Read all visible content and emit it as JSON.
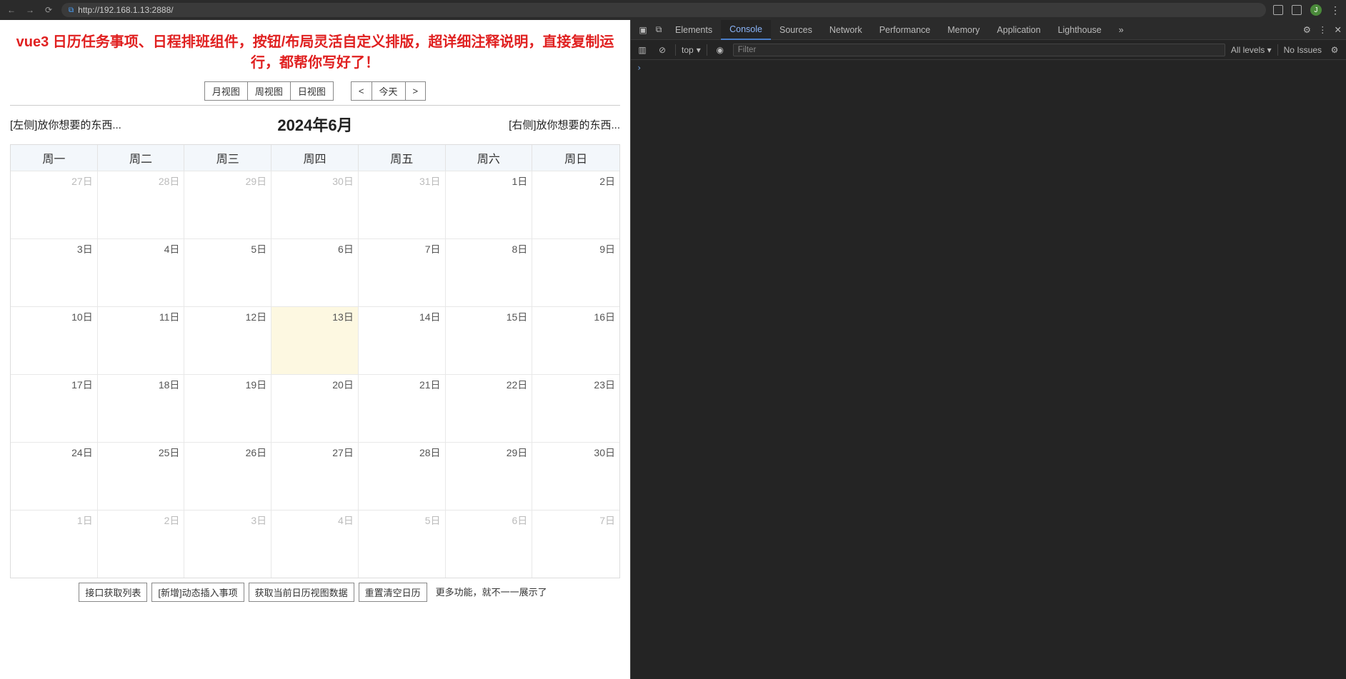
{
  "browser": {
    "url": "http://192.168.1.13:2888/",
    "avatar_letter": "J"
  },
  "page": {
    "title": "vue3 日历任务事项、日程排班组件，按钮/布局灵活自定义排版，超详细注释说明，直接复制运行，都帮你写好了！",
    "view_buttons": [
      "月视图",
      "周视图",
      "日视图"
    ],
    "nav_prev": "<",
    "nav_today": "今天",
    "nav_next": ">",
    "left_slot": "[左侧]放你想要的东西...",
    "right_slot": "[右侧]放你想要的东西...",
    "month_title": "2024年6月",
    "weekdays": [
      "周一",
      "周二",
      "周三",
      "周四",
      "周五",
      "周六",
      "周日"
    ],
    "days": [
      {
        "label": "27日",
        "outside": true
      },
      {
        "label": "28日",
        "outside": true
      },
      {
        "label": "29日",
        "outside": true
      },
      {
        "label": "30日",
        "outside": true
      },
      {
        "label": "31日",
        "outside": true
      },
      {
        "label": "1日"
      },
      {
        "label": "2日"
      },
      {
        "label": "3日"
      },
      {
        "label": "4日"
      },
      {
        "label": "5日"
      },
      {
        "label": "6日"
      },
      {
        "label": "7日"
      },
      {
        "label": "8日"
      },
      {
        "label": "9日"
      },
      {
        "label": "10日"
      },
      {
        "label": "11日"
      },
      {
        "label": "12日"
      },
      {
        "label": "13日",
        "today": true
      },
      {
        "label": "14日"
      },
      {
        "label": "15日"
      },
      {
        "label": "16日"
      },
      {
        "label": "17日"
      },
      {
        "label": "18日"
      },
      {
        "label": "19日"
      },
      {
        "label": "20日"
      },
      {
        "label": "21日"
      },
      {
        "label": "22日"
      },
      {
        "label": "23日"
      },
      {
        "label": "24日"
      },
      {
        "label": "25日"
      },
      {
        "label": "26日"
      },
      {
        "label": "27日"
      },
      {
        "label": "28日"
      },
      {
        "label": "29日"
      },
      {
        "label": "30日"
      },
      {
        "label": "1日",
        "outside": true
      },
      {
        "label": "2日",
        "outside": true
      },
      {
        "label": "3日",
        "outside": true
      },
      {
        "label": "4日",
        "outside": true
      },
      {
        "label": "5日",
        "outside": true
      },
      {
        "label": "6日",
        "outside": true
      },
      {
        "label": "7日",
        "outside": true
      }
    ],
    "bottom_buttons": [
      "接口获取列表",
      "[新增]动态插入事项",
      "获取当前日历视图数据",
      "重置清空日历"
    ],
    "bottom_note": "更多功能，就不一一展示了"
  },
  "devtools": {
    "tabs": [
      "Elements",
      "Console",
      "Sources",
      "Network",
      "Performance",
      "Memory",
      "Application",
      "Lighthouse"
    ],
    "active_tab": "Console",
    "more": "»",
    "toolbar": {
      "context": "top",
      "context_arrow": "▾",
      "filter_placeholder": "Filter",
      "levels": "All levels ▾",
      "issues": "No Issues"
    },
    "prompt": "›"
  }
}
